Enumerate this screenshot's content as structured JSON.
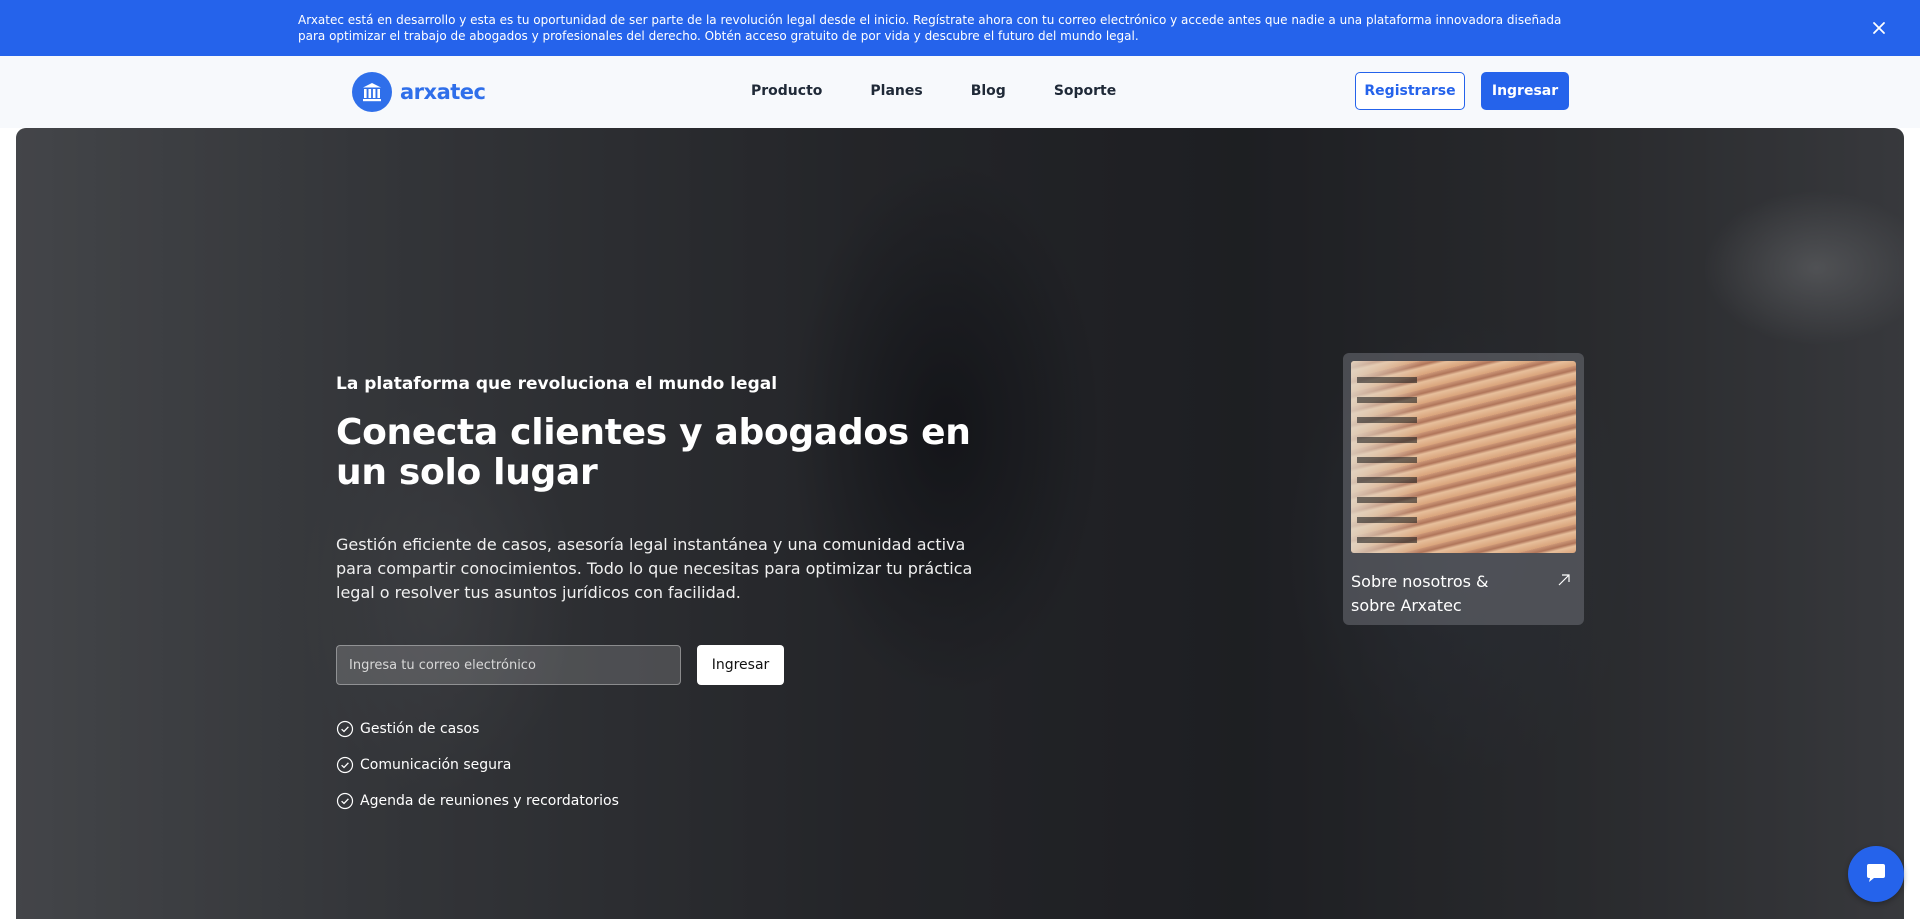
{
  "banner": {
    "text": "Arxatec está en desarrollo y esta es tu oportunidad de ser parte de la revolución legal desde el inicio. Regístrate ahora con tu correo electrónico y accede antes que nadie a una plataforma innovadora diseñada para optimizar el trabajo de abogados y profesionales del derecho. Obtén acceso gratuito de por vida y descubre el futuro del mundo legal.",
    "close_icon": "close-icon"
  },
  "header": {
    "logo_text": "arxatec",
    "logo_icon": "courthouse-icon",
    "nav": [
      "Producto",
      "Planes",
      "Blog",
      "Soporte"
    ],
    "register_label": "Registrarse",
    "login_label": "Ingresar"
  },
  "hero": {
    "eyebrow": "La plataforma que revoluciona el mundo legal",
    "headline": "Conecta clientes y abogados en un solo lugar",
    "description": "Gestión eficiente de casos, asesoría legal instantánea y una comunidad activa para compartir conocimientos. Todo lo que necesitas para optimizar tu práctica legal o resolver tus asuntos jurídicos con facilidad.",
    "email_placeholder": "Ingresa tu correo electrónico",
    "submit_label": "Ingresar",
    "features": [
      "Gestión de casos",
      "Comunicación segura",
      "Agenda de reuniones y recordatorios"
    ]
  },
  "card": {
    "title": "Sobre nosotros & sobre Arxatec",
    "arrow_icon": "arrow-up-right-icon"
  },
  "chat": {
    "icon": "chat-bubble-icon"
  },
  "colors": {
    "brand": "#2563eb",
    "logo": "#2f6fea"
  }
}
